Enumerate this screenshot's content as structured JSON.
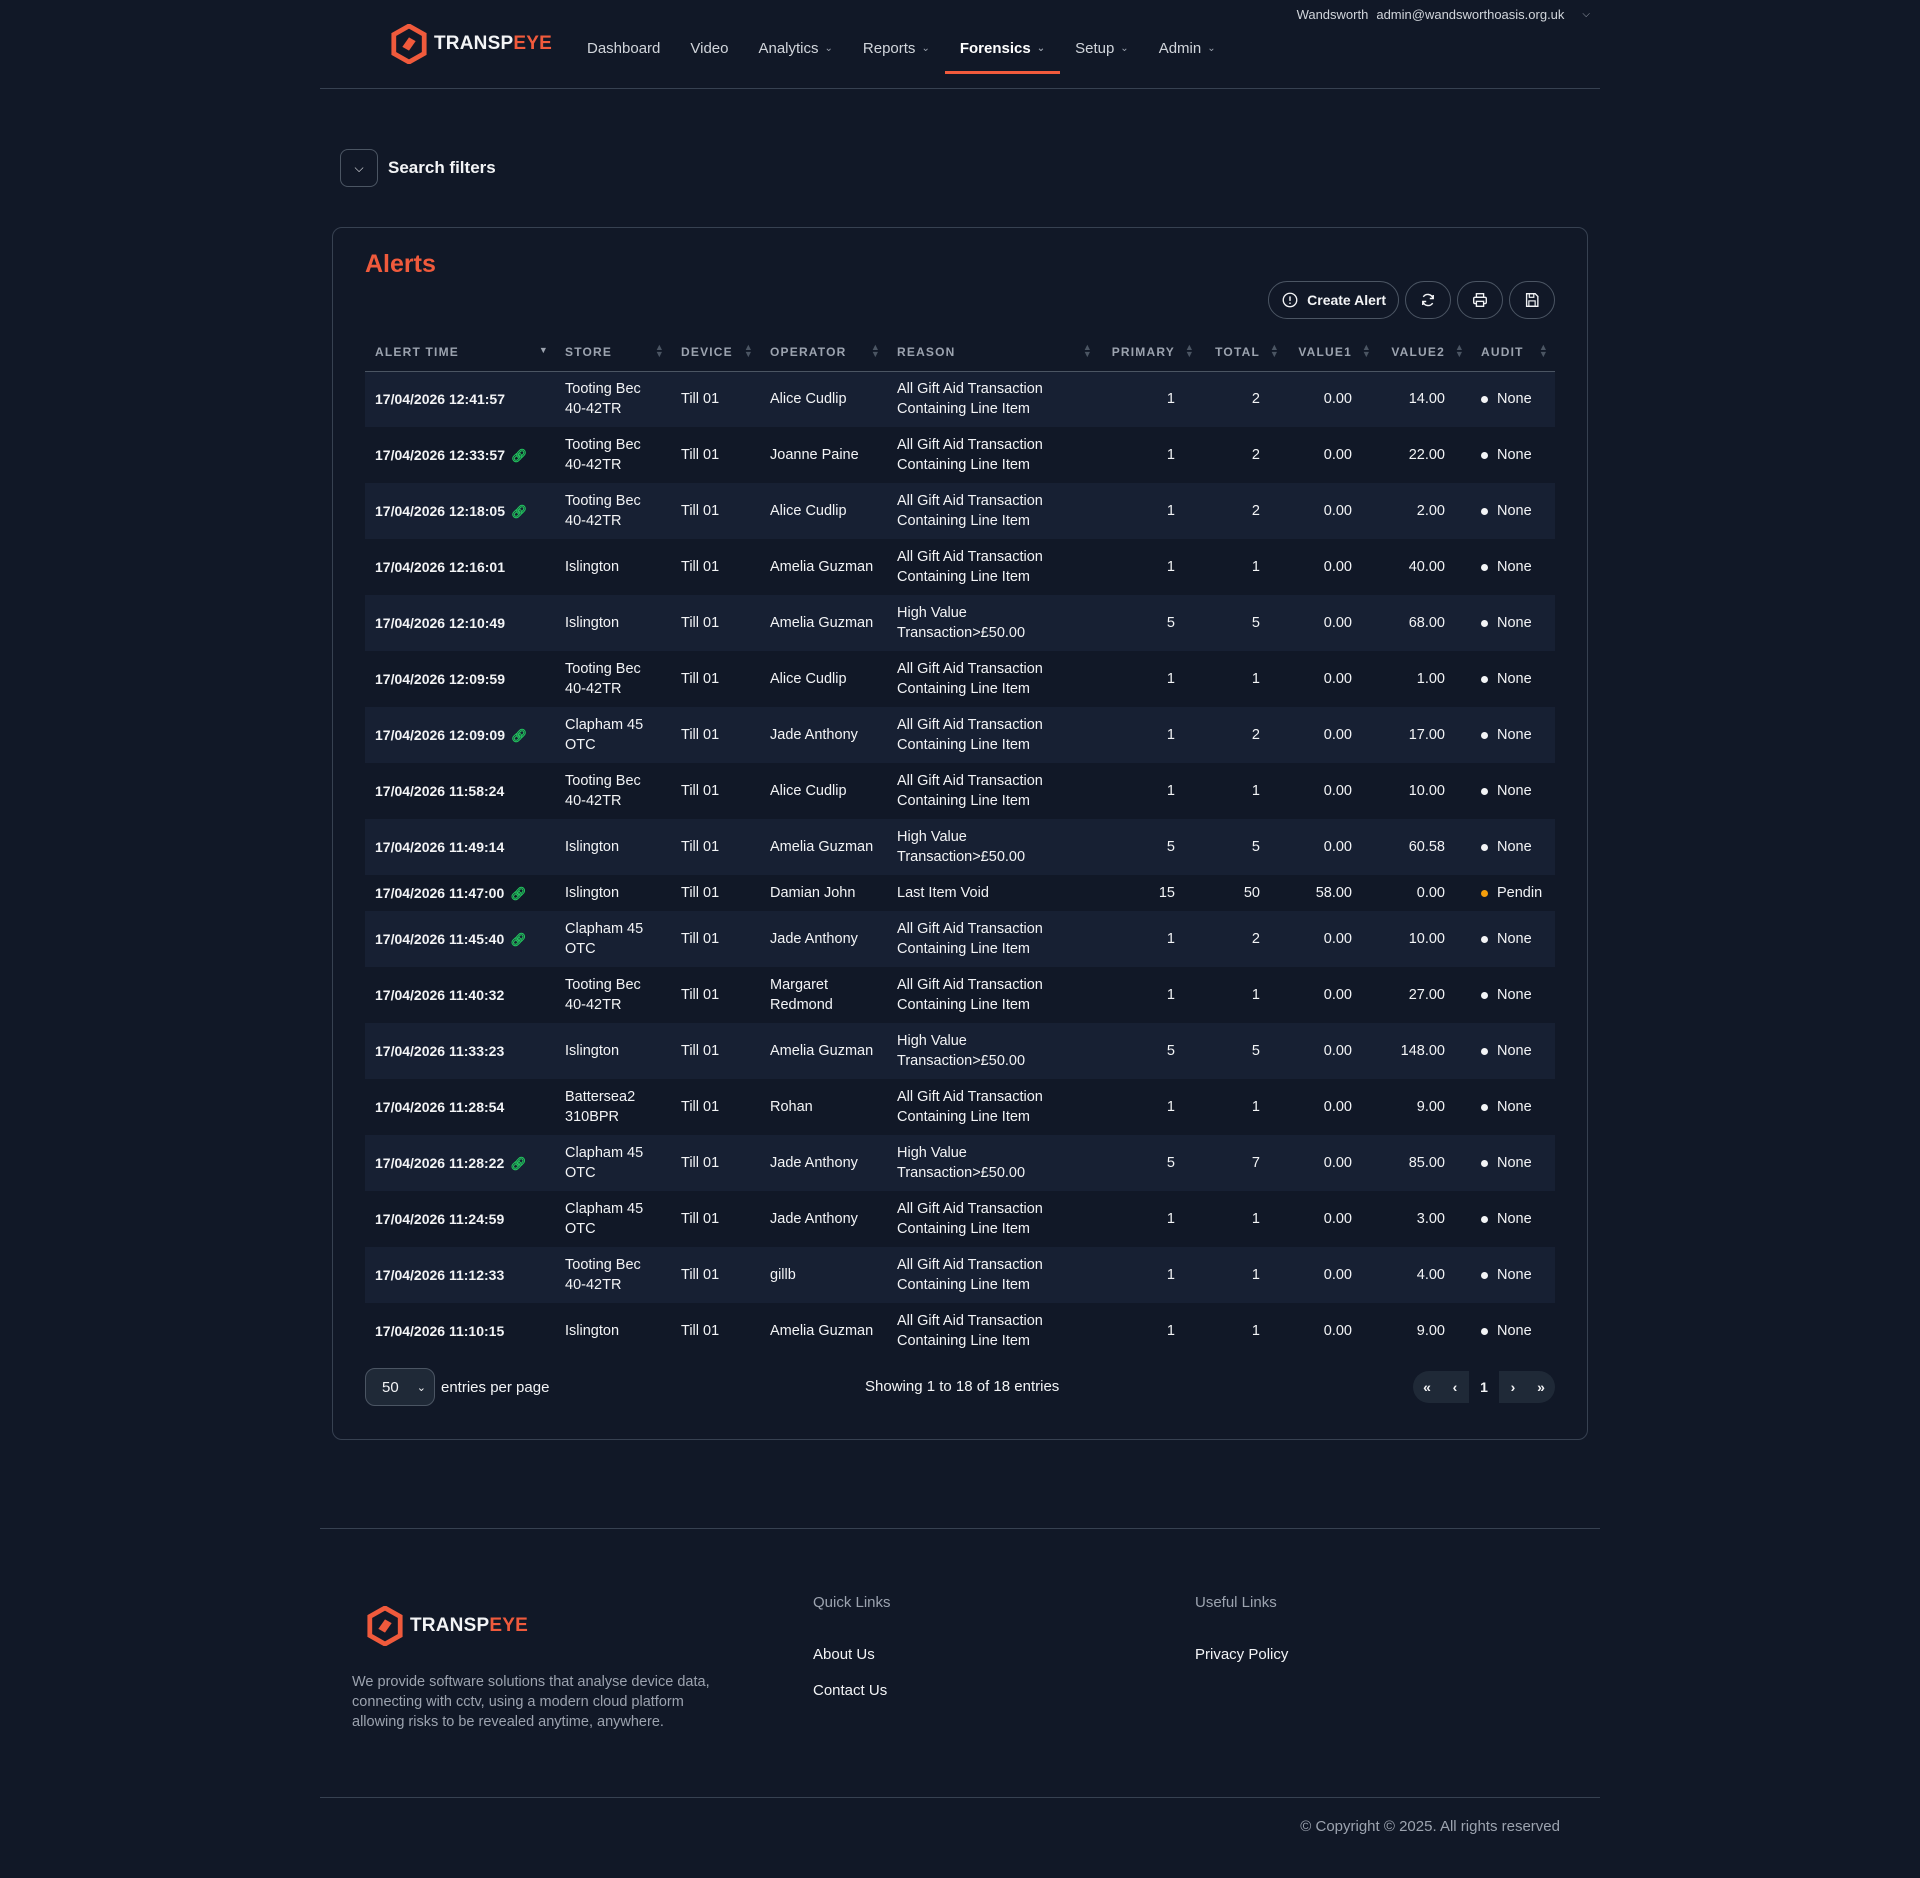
{
  "header": {
    "org": "Wandsworth",
    "email": "admin@wandsworthoasis.org.uk",
    "logo_main": "TRANSP",
    "logo_accent": "EYE",
    "nav": [
      {
        "label": "Dashboard"
      },
      {
        "label": "Video"
      },
      {
        "label": "Analytics"
      },
      {
        "label": "Reports"
      },
      {
        "label": "Forensics"
      },
      {
        "label": "Setup"
      },
      {
        "label": "Admin"
      }
    ]
  },
  "filters": {
    "label": "Search filters"
  },
  "alerts": {
    "title": "Alerts",
    "create_label": "Create Alert",
    "columns": [
      "Alert Time",
      "Store",
      "Device",
      "Operator",
      "Reason",
      "Primary",
      "Total",
      "Value1",
      "Value2",
      "Audit"
    ],
    "rows": [
      {
        "time": "17/04/2026 12:41:57",
        "linked": false,
        "store": [
          "Tooting Bec",
          "40-42TR"
        ],
        "device": "Till 01",
        "operator": [
          "Alice Cudlip"
        ],
        "reason": [
          "All Gift Aid Transaction",
          "Containing Line Item"
        ],
        "primary": "1",
        "total": "2",
        "value1": "0.00",
        "value2": "14.00",
        "audit": "None",
        "pending": false
      },
      {
        "time": "17/04/2026 12:33:57",
        "linked": true,
        "store": [
          "Tooting Bec",
          "40-42TR"
        ],
        "device": "Till 01",
        "operator": [
          "Joanne Paine"
        ],
        "reason": [
          "All Gift Aid Transaction",
          "Containing Line Item"
        ],
        "primary": "1",
        "total": "2",
        "value1": "0.00",
        "value2": "22.00",
        "audit": "None",
        "pending": false
      },
      {
        "time": "17/04/2026 12:18:05",
        "linked": true,
        "store": [
          "Tooting Bec",
          "40-42TR"
        ],
        "device": "Till 01",
        "operator": [
          "Alice Cudlip"
        ],
        "reason": [
          "All Gift Aid Transaction",
          "Containing Line Item"
        ],
        "primary": "1",
        "total": "2",
        "value1": "0.00",
        "value2": "2.00",
        "audit": "None",
        "pending": false
      },
      {
        "time": "17/04/2026 12:16:01",
        "linked": false,
        "store": [
          "Islington"
        ],
        "device": "Till 01",
        "operator": [
          "Amelia Guzman"
        ],
        "reason": [
          "All Gift Aid Transaction",
          "Containing Line Item"
        ],
        "primary": "1",
        "total": "1",
        "value1": "0.00",
        "value2": "40.00",
        "audit": "None",
        "pending": false
      },
      {
        "time": "17/04/2026 12:10:49",
        "linked": false,
        "store": [
          "Islington"
        ],
        "device": "Till 01",
        "operator": [
          "Amelia Guzman"
        ],
        "reason": [
          "High Value",
          "Transaction>£50.00"
        ],
        "primary": "5",
        "total": "5",
        "value1": "0.00",
        "value2": "68.00",
        "audit": "None",
        "pending": false
      },
      {
        "time": "17/04/2026 12:09:59",
        "linked": false,
        "store": [
          "Tooting Bec",
          "40-42TR"
        ],
        "device": "Till 01",
        "operator": [
          "Alice Cudlip"
        ],
        "reason": [
          "All Gift Aid Transaction",
          "Containing Line Item"
        ],
        "primary": "1",
        "total": "1",
        "value1": "0.00",
        "value2": "1.00",
        "audit": "None",
        "pending": false
      },
      {
        "time": "17/04/2026 12:09:09",
        "linked": true,
        "store": [
          "Clapham 45",
          "OTC"
        ],
        "device": "Till 01",
        "operator": [
          "Jade Anthony"
        ],
        "reason": [
          "All Gift Aid Transaction",
          "Containing Line Item"
        ],
        "primary": "1",
        "total": "2",
        "value1": "0.00",
        "value2": "17.00",
        "audit": "None",
        "pending": false
      },
      {
        "time": "17/04/2026 11:58:24",
        "linked": false,
        "store": [
          "Tooting Bec",
          "40-42TR"
        ],
        "device": "Till 01",
        "operator": [
          "Alice Cudlip"
        ],
        "reason": [
          "All Gift Aid Transaction",
          "Containing Line Item"
        ],
        "primary": "1",
        "total": "1",
        "value1": "0.00",
        "value2": "10.00",
        "audit": "None",
        "pending": false
      },
      {
        "time": "17/04/2026 11:49:14",
        "linked": false,
        "store": [
          "Islington"
        ],
        "device": "Till 01",
        "operator": [
          "Amelia Guzman"
        ],
        "reason": [
          "High Value",
          "Transaction>£50.00"
        ],
        "primary": "5",
        "total": "5",
        "value1": "0.00",
        "value2": "60.58",
        "audit": "None",
        "pending": false
      },
      {
        "time": "17/04/2026 11:47:00",
        "linked": true,
        "store": [
          "Islington"
        ],
        "device": "Till 01",
        "operator": [
          "Damian John"
        ],
        "reason": [
          "Last Item Void"
        ],
        "primary": "15",
        "total": "50",
        "value1": "58.00",
        "value2": "0.00",
        "audit": "Pendin",
        "pending": true
      },
      {
        "time": "17/04/2026 11:45:40",
        "linked": true,
        "store": [
          "Clapham 45",
          "OTC"
        ],
        "device": "Till 01",
        "operator": [
          "Jade Anthony"
        ],
        "reason": [
          "All Gift Aid Transaction",
          "Containing Line Item"
        ],
        "primary": "1",
        "total": "2",
        "value1": "0.00",
        "value2": "10.00",
        "audit": "None",
        "pending": false
      },
      {
        "time": "17/04/2026 11:40:32",
        "linked": false,
        "store": [
          "Tooting Bec",
          "40-42TR"
        ],
        "device": "Till 01",
        "operator": [
          "Margaret",
          "Redmond"
        ],
        "reason": [
          "All Gift Aid Transaction",
          "Containing Line Item"
        ],
        "primary": "1",
        "total": "1",
        "value1": "0.00",
        "value2": "27.00",
        "audit": "None",
        "pending": false
      },
      {
        "time": "17/04/2026 11:33:23",
        "linked": false,
        "store": [
          "Islington"
        ],
        "device": "Till 01",
        "operator": [
          "Amelia Guzman"
        ],
        "reason": [
          "High Value",
          "Transaction>£50.00"
        ],
        "primary": "5",
        "total": "5",
        "value1": "0.00",
        "value2": "148.00",
        "audit": "None",
        "pending": false
      },
      {
        "time": "17/04/2026 11:28:54",
        "linked": false,
        "store": [
          "Battersea2",
          "310BPR"
        ],
        "device": "Till 01",
        "operator": [
          "Rohan"
        ],
        "reason": [
          "All Gift Aid Transaction",
          "Containing Line Item"
        ],
        "primary": "1",
        "total": "1",
        "value1": "0.00",
        "value2": "9.00",
        "audit": "None",
        "pending": false
      },
      {
        "time": "17/04/2026 11:28:22",
        "linked": true,
        "store": [
          "Clapham 45",
          "OTC"
        ],
        "device": "Till 01",
        "operator": [
          "Jade Anthony"
        ],
        "reason": [
          "High Value",
          "Transaction>£50.00"
        ],
        "primary": "5",
        "total": "7",
        "value1": "0.00",
        "value2": "85.00",
        "audit": "None",
        "pending": false
      },
      {
        "time": "17/04/2026 11:24:59",
        "linked": false,
        "store": [
          "Clapham 45",
          "OTC"
        ],
        "device": "Till 01",
        "operator": [
          "Jade Anthony"
        ],
        "reason": [
          "All Gift Aid Transaction",
          "Containing Line Item"
        ],
        "primary": "1",
        "total": "1",
        "value1": "0.00",
        "value2": "3.00",
        "audit": "None",
        "pending": false
      },
      {
        "time": "17/04/2026 11:12:33",
        "linked": false,
        "store": [
          "Tooting Bec",
          "40-42TR"
        ],
        "device": "Till 01",
        "operator": [
          "gillb"
        ],
        "reason": [
          "All Gift Aid Transaction",
          "Containing Line Item"
        ],
        "primary": "1",
        "total": "1",
        "value1": "0.00",
        "value2": "4.00",
        "audit": "None",
        "pending": false
      },
      {
        "time": "17/04/2026 11:10:15",
        "linked": false,
        "store": [
          "Islington"
        ],
        "device": "Till 01",
        "operator": [
          "Amelia Guzman"
        ],
        "reason": [
          "All Gift Aid Transaction",
          "Containing Line Item"
        ],
        "primary": "1",
        "total": "1",
        "value1": "0.00",
        "value2": "9.00",
        "audit": "None",
        "pending": false
      }
    ],
    "per_page_value": "50",
    "per_page_label": "entries per page",
    "info": "Showing 1 to 18 of 18 entries",
    "pager": {
      "first": "«",
      "prev": "‹",
      "current": "1",
      "next": "›",
      "last": "»"
    }
  },
  "footer": {
    "description": "We provide software solutions that analyse device data, connecting with cctv, using a modern cloud platform allowing risks to be revealed anytime, anywhere.",
    "quick_links_title": "Quick Links",
    "quick_links": [
      "About Us",
      "Contact Us"
    ],
    "useful_links_title": "Useful Links",
    "useful_links": [
      "Privacy Policy"
    ],
    "copyright": "© Copyright © 2025. All rights reserved"
  },
  "colors": {
    "accent": "#f05a3c",
    "background": "#111827",
    "link_icon": "#22c55e",
    "pending": "#f59e0b"
  },
  "icons": [
    "chevron-down-icon",
    "alert-circle-icon",
    "refresh-icon",
    "print-icon",
    "save-icon",
    "link-icon",
    "sort-icon"
  ]
}
